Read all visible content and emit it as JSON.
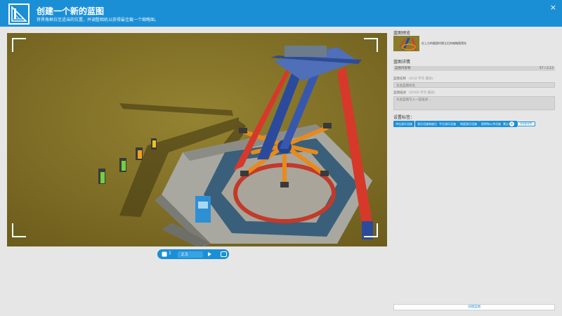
{
  "header": {
    "title": "创建一个新的蓝图",
    "subtitle": "将界角框拉至适当的位置，并调整相机以获得最佳截一个缩略图。",
    "close_label": "×"
  },
  "camera_bar": {
    "number": "1",
    "field_value": "2.5"
  },
  "panel": {
    "preview_label": "蓝图预览",
    "preview_note": "在上方的截图时建立后的缩略图预览",
    "info_label": "蓝图详情",
    "count_label": "蓝图内容物",
    "count_value": "57 / 2,12",
    "name_label": "蓝图名称",
    "name_hint": "(0/32 字元 最高)",
    "name_placeholder": "为此蓝图命名",
    "desc_label": "蓝图描述",
    "desc_hint": "(0/500 字元 最高)",
    "desc_placeholder": "为此蓝图写入一些描述...",
    "tags_label": "设置标签：",
    "tags": [
      "冲击游乐设施",
      "游乐设施和座位",
      "平台游乐设施",
      "地面游乐设施",
      "照明和公共设施",
      "景点"
    ],
    "add_tag_label": "添加新标签",
    "create_label": "创建蓝图"
  },
  "colors": {
    "accent": "#1b8fd6",
    "background": "#e6e6e6",
    "tower_red": "#d6392a",
    "tower_blue": "#2c4a9c",
    "arm_orange": "#e88a1c"
  }
}
